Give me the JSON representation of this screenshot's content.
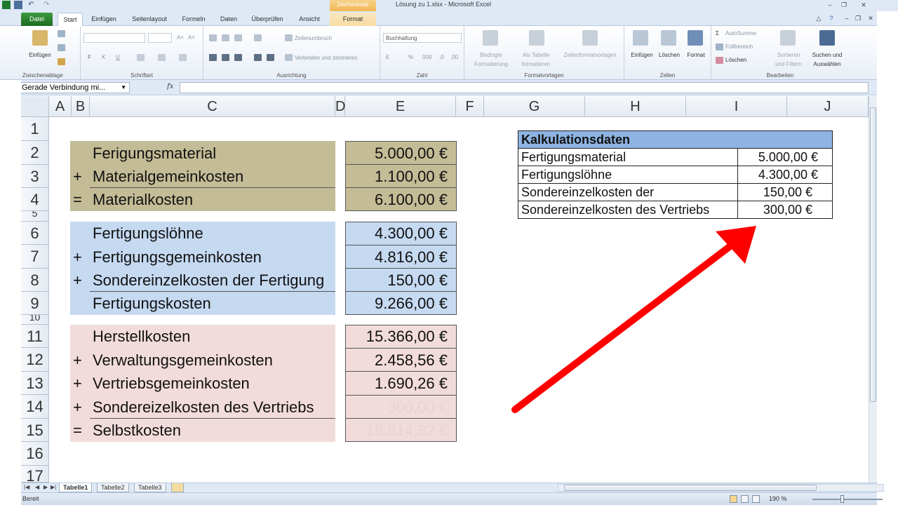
{
  "window": {
    "title": "Lösung zu 1.xlsx - Microsoft Excel",
    "context_tools": "Zeichentools"
  },
  "tabs": [
    "Datei",
    "Start",
    "Einfügen",
    "Seitenlayout",
    "Formeln",
    "Daten",
    "Überprüfen",
    "Ansicht",
    "Format"
  ],
  "ribbon": {
    "clipboard": {
      "label": "Zwischenablage",
      "paste": "Einfügen"
    },
    "font": {
      "label": "Schriftart",
      "bold": "F",
      "italic": "K",
      "underline": "U"
    },
    "alignment": {
      "label": "Ausrichtung",
      "wrap": "Zeilenumbruch",
      "merge": "Verbinden und zentrieren"
    },
    "number": {
      "label": "Zahl",
      "format": "Buchhaltung"
    },
    "styles": {
      "label": "Formatvorlagen",
      "conditional_1": "Bedingte",
      "conditional_2": "Formatierung",
      "astable_1": "Als Tabelle",
      "astable_2": "formatieren",
      "cellstyles": "Zellenformatvorlagen"
    },
    "cells": {
      "label": "Zellen",
      "insert": "Einfügen",
      "delete": "Löschen",
      "format": "Format"
    },
    "editing": {
      "label": "Bearbeiten",
      "autosum": "AutoSumme",
      "fill": "Füllbereich",
      "clear": "Löschen",
      "sort_1": "Sortieren",
      "sort_2": "und Filtern",
      "find_1": "Suchen und",
      "find_2": "Auswählen"
    }
  },
  "formula_bar": {
    "name_box": "Gerade Verbindung mi...",
    "fx": "fx",
    "formula": ""
  },
  "columns": [
    "A",
    "B",
    "C",
    "D",
    "E",
    "F",
    "G",
    "H",
    "I",
    "J"
  ],
  "rows": [
    "1",
    "2",
    "3",
    "4",
    "5",
    "6",
    "7",
    "8",
    "9",
    "10",
    "11",
    "12",
    "13",
    "14",
    "15",
    "16",
    "17"
  ],
  "sheet": {
    "material": [
      {
        "op": "",
        "label": "Ferigungsmaterial",
        "value": "5.000,00 €"
      },
      {
        "op": "+",
        "label": "Materialgemeinkosten",
        "value": "1.100,00 €"
      },
      {
        "op": "=",
        "label": "Materialkosten",
        "value": "6.100,00 €"
      }
    ],
    "fertigung": [
      {
        "op": "",
        "label": "Fertigungslöhne",
        "value": "4.300,00 €"
      },
      {
        "op": "+",
        "label": "Fertigungsgemeinkosten",
        "value": "4.816,00 €"
      },
      {
        "op": "+",
        "label": "Sondereinzelkosten der Fertigung",
        "value": "150,00 €"
      },
      {
        "op": "",
        "label": "Fertigungskosten",
        "value": "9.266,00 €"
      }
    ],
    "selbstkosten": [
      {
        "op": "",
        "label": "Herstellkosten",
        "value": "15.366,00 €"
      },
      {
        "op": "+",
        "label": "Verwaltungsgemeinkosten",
        "value": "2.458,56 €"
      },
      {
        "op": "+",
        "label": "Vertriebsgemeinkosten",
        "value": "1.690,26 €"
      },
      {
        "op": "+",
        "label": "Sondereizelkosten des Vertriebs",
        "value": "300,00 €"
      },
      {
        "op": "=",
        "label": "Selbstkosten",
        "value": "19.814,82 €"
      }
    ]
  },
  "kalkulationsdaten": {
    "title": "Kalkulationsdaten",
    "rows": [
      {
        "name": "Fertigungsmaterial",
        "value": "5.000,00 €"
      },
      {
        "name": "Fertigungslöhne",
        "value": "4.300,00 €"
      },
      {
        "name": "Sondereinzelkosten der",
        "value": "150,00 €"
      },
      {
        "name": "Sondereinzelkosten des Vertriebs",
        "value": "300,00 €"
      }
    ]
  },
  "colors": {
    "material_fill": "#c4bc96",
    "fertigung_fill": "#c5d9f1",
    "selbst_fill": "#f2dcdb",
    "header_fill": "#8db4e2",
    "arrow": "#ff0000"
  },
  "sheet_tabs": [
    "Tabelle1",
    "Tabelle2",
    "Tabelle3"
  ],
  "status": {
    "ready": "Bereit",
    "zoom": "190 %"
  }
}
